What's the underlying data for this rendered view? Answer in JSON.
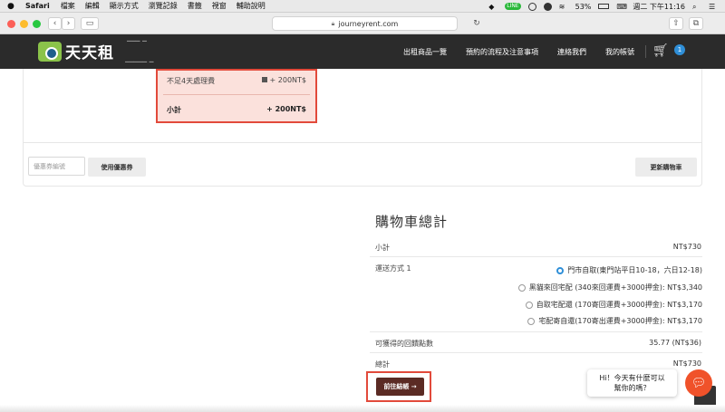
{
  "menubar": {
    "app": "Safari",
    "items": [
      "檔案",
      "編輯",
      "顯示方式",
      "瀏覽記錄",
      "書籤",
      "視窗",
      "輔助說明"
    ],
    "battery": "53%",
    "clock": "週二 下午11:16"
  },
  "browser": {
    "url": "journeyrent.com"
  },
  "site": {
    "logo_text": "天天租",
    "nav": [
      "出租商品一覽",
      "預約的流程及注意事項",
      "連絡我們",
      "我的帳號"
    ],
    "cart_count": "1"
  },
  "cart_panel": {
    "faded_1": "─── ─",
    "faded_2": "───── ─",
    "fee_label": "不足4天處理費",
    "fee_value": "+ 200NT$",
    "subtotal_label": "小計",
    "subtotal_value": "+ 200NT$",
    "coupon_placeholder": "優惠券編號",
    "apply_coupon": "使用優惠券",
    "update_cart": "更新購物車"
  },
  "totals": {
    "title": "購物車總計",
    "subtotal_label": "小計",
    "subtotal_value": "NT$730",
    "shipping_label": "運送方式 1",
    "shipping_options": [
      "門市自取(東門站平日10-18，六日12-18)",
      "黑貓來回宅配 (340來回運費+3000押金): NT$3,340",
      "自取宅配還 (170寄回運費+3000押金): NT$3,170",
      "宅配寄自還(170寄出運費+3000押金): NT$3,170"
    ],
    "selected_shipping_index": 0,
    "points_label": "可獲得的回饋點數",
    "points_value": "35.77 (NT$36)",
    "total_label": "總計",
    "total_value": "NT$730",
    "checkout": "前往結帳 →"
  },
  "chat": {
    "line1": "Hi！今天有什麼可以",
    "line2": "幫你的嗎？"
  },
  "colors": {
    "header_bg": "#2b2b2b",
    "highlight_border": "#e24a3b",
    "highlight_fill": "#fbe1dc",
    "checkout_bg": "#5b2b24",
    "accent_blue": "#2f8fd8",
    "chat_orange": "#f0522a"
  }
}
